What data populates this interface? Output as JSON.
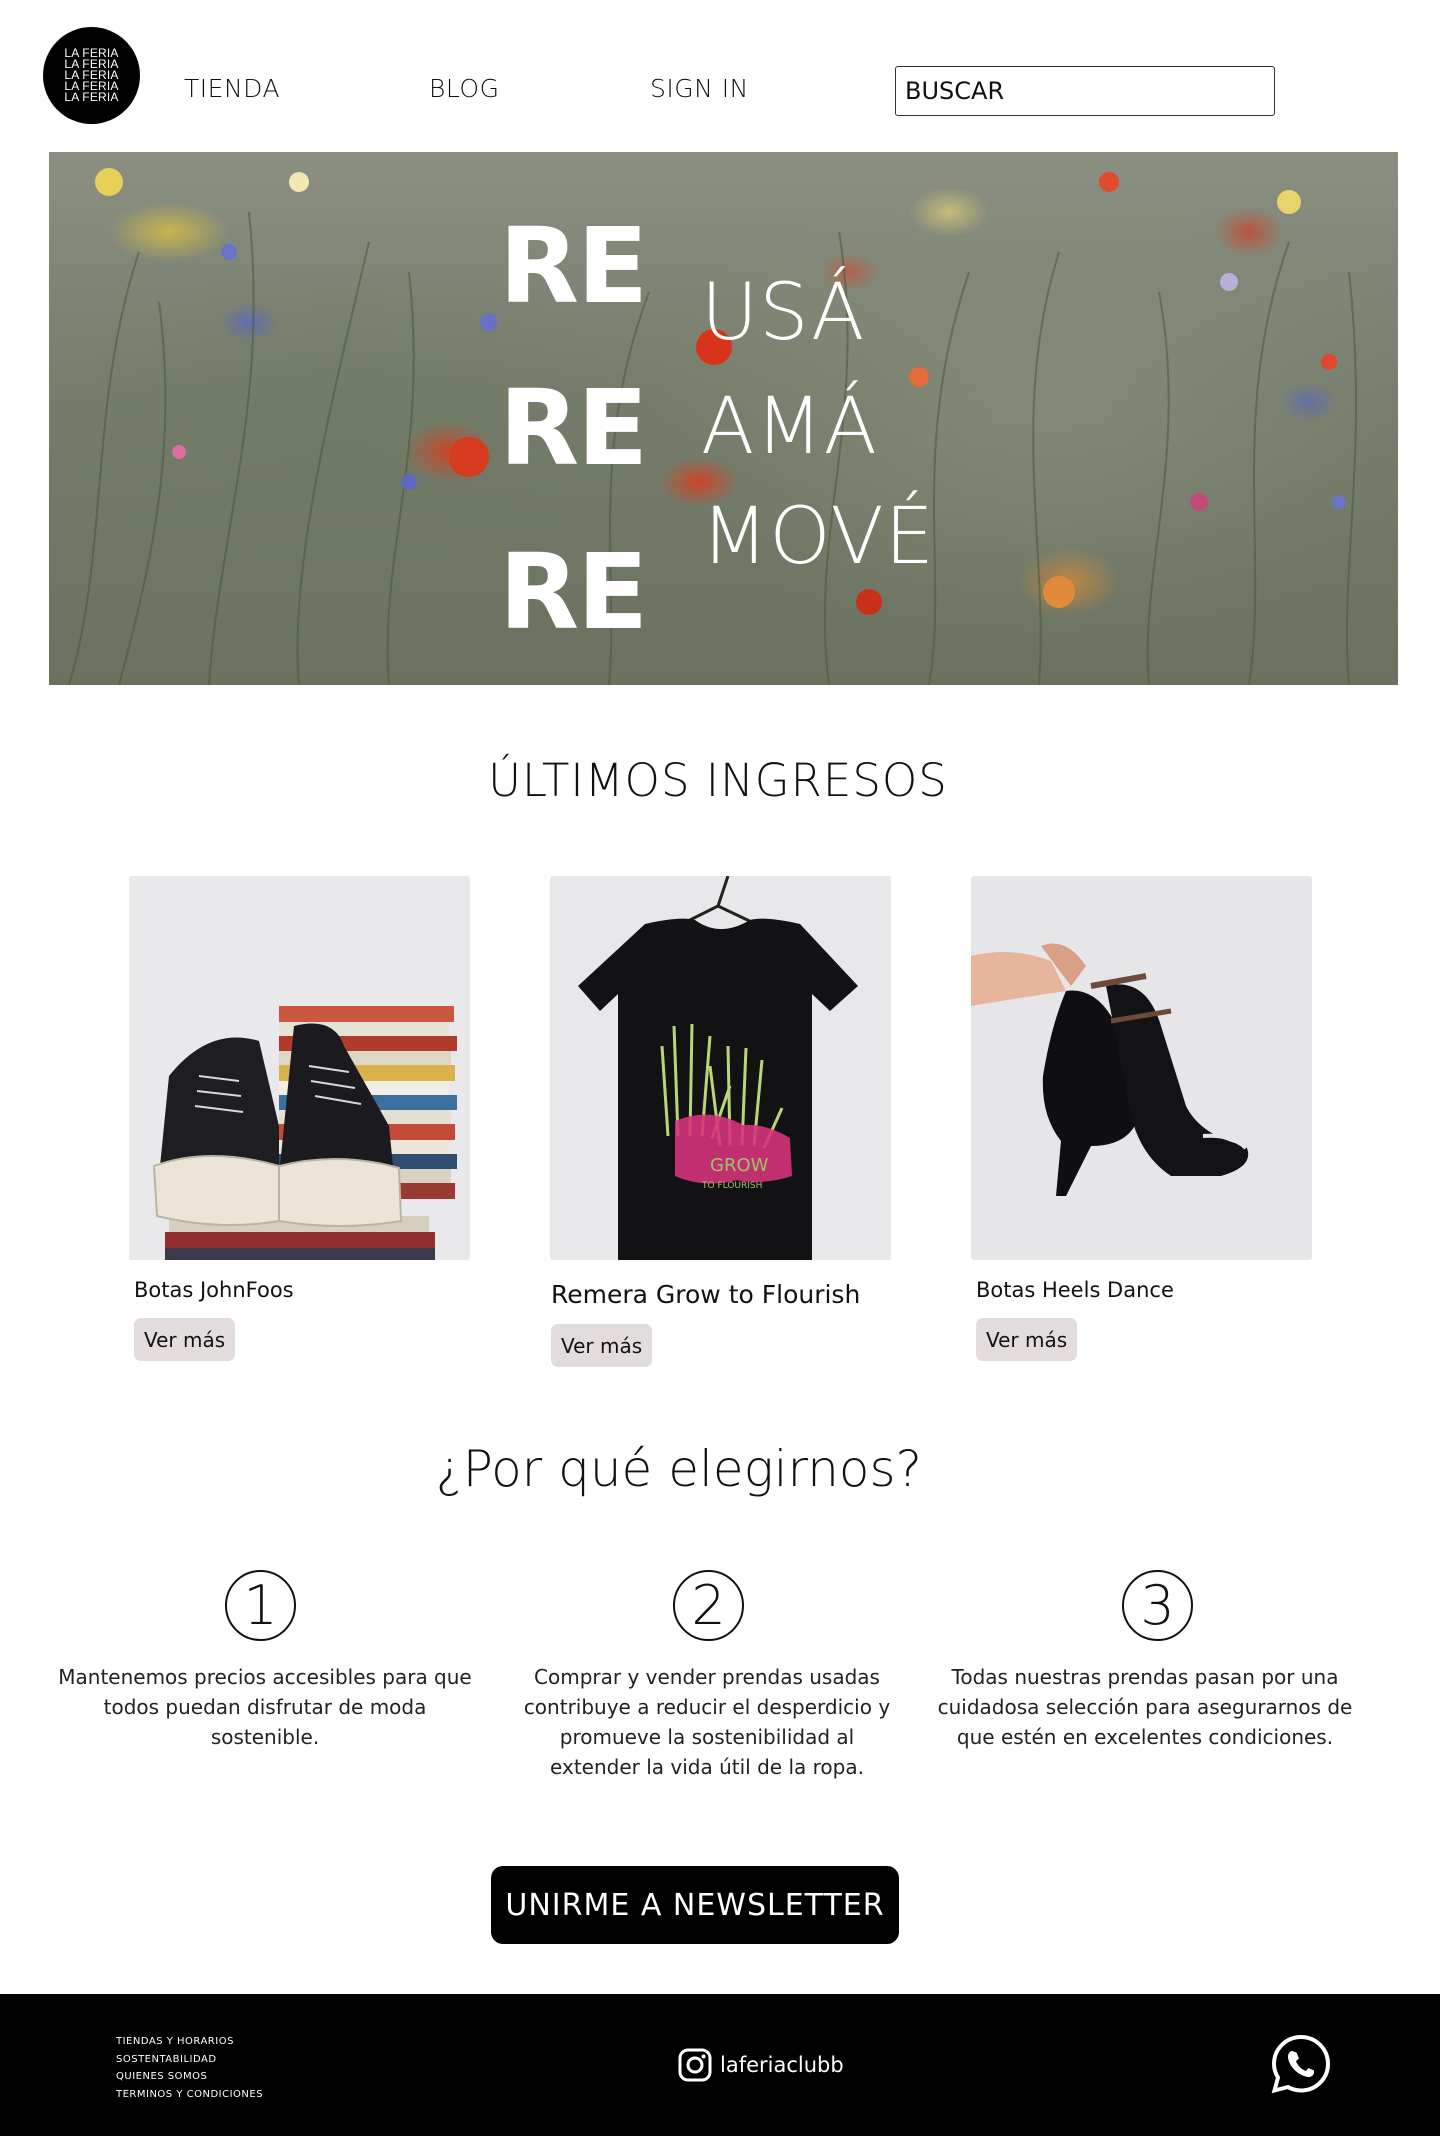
{
  "brand": {
    "logo_lines": [
      "LA FERIA",
      "LA FERIA",
      "LA FERIA",
      "LA FERIA",
      "LA FERIA"
    ]
  },
  "nav": {
    "items": [
      "TIENDA",
      "BLOG",
      "SIGN IN"
    ],
    "search_placeholder": "BUSCAR"
  },
  "hero": {
    "prefixes": [
      "RE",
      "RE",
      "RE"
    ],
    "words": [
      "USÁ",
      "AMÁ",
      "MOVÉ"
    ]
  },
  "latest": {
    "title": "ÚLTIMOS INGRESOS",
    "products": [
      {
        "name": "Botas JohnFoos",
        "button": "Ver más"
      },
      {
        "name": "Remera Grow to Flourish",
        "button": "Ver más",
        "print_text": [
          "GROW",
          "TO FLOURISH"
        ]
      },
      {
        "name": "Botas Heels Dance",
        "button": "Ver más"
      }
    ]
  },
  "why": {
    "title": "¿Por qué elegirnos?",
    "reasons": [
      {
        "number": "1",
        "text": "Mantenemos precios accesibles para que todos puedan disfrutar de moda sostenible."
      },
      {
        "number": "2",
        "text": "Comprar y vender prendas usadas contribuye a reducir el desperdicio y promueve la sostenibilidad al extender la vida útil de la ropa."
      },
      {
        "number": "3",
        "text": "Todas nuestras prendas pasan por una cuidadosa selección para asegurarnos de que estén en excelentes condiciones."
      }
    ]
  },
  "newsletter": {
    "label": "UNIRME A NEWSLETTER"
  },
  "footer": {
    "links": [
      "TIENDAS Y HORARIOS",
      "SOSTENTABILIDAD",
      "QUIENES SOMOS",
      "TERMINOS Y CONDICIONES"
    ],
    "instagram_handle": "laferiaclubb",
    "icons": [
      "instagram-icon",
      "whatsapp-icon"
    ]
  },
  "colors": {
    "background": "#ffffff",
    "footer": "#000000",
    "button_bg": "#e3dcdc",
    "newsletter_bg": "#000000"
  }
}
